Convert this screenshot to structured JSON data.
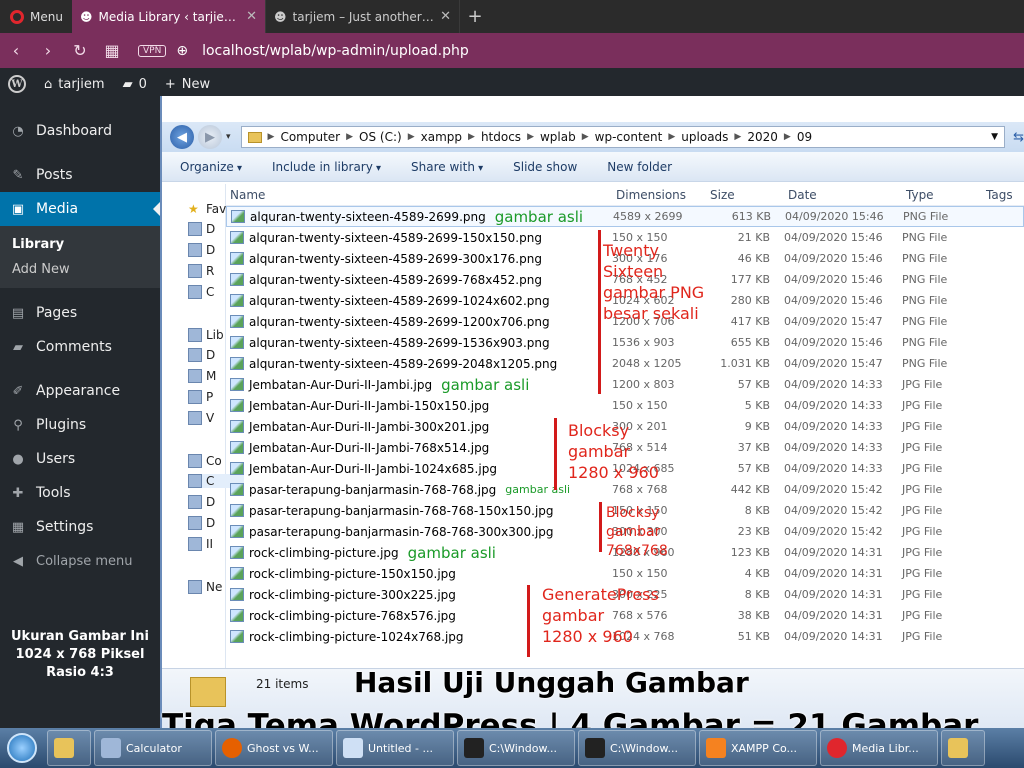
{
  "browser": {
    "menu_label": "Menu",
    "tabs": [
      {
        "label": "Media Library ‹ tarjiem — W"
      },
      {
        "label": "tarjiem – Just another Word"
      }
    ],
    "vpn_label": "VPN",
    "url": "localhost/wplab/wp-admin/upload.php"
  },
  "wp_admin_bar": {
    "site_name": "tarjiem",
    "comments_count": "0",
    "new_label": "New"
  },
  "sidebar": {
    "items": [
      {
        "label": "Dashboard",
        "icon": "dashboard-icon"
      },
      {
        "label": "Posts",
        "icon": "pin-icon"
      },
      {
        "label": "Media",
        "icon": "media-icon"
      },
      {
        "label": "Pages",
        "icon": "page-icon"
      },
      {
        "label": "Comments",
        "icon": "comment-icon"
      },
      {
        "label": "Appearance",
        "icon": "brush-icon"
      },
      {
        "label": "Plugins",
        "icon": "plugin-icon"
      },
      {
        "label": "Users",
        "icon": "user-icon"
      },
      {
        "label": "Tools",
        "icon": "wrench-icon"
      },
      {
        "label": "Settings",
        "icon": "settings-icon"
      }
    ],
    "media_sub": [
      "Library",
      "Add New"
    ],
    "collapse_label": "Collapse menu",
    "caption_lines": [
      "Ukuran Gambar Ini",
      "1024 x 768 Piksel",
      "Rasio 4:3"
    ]
  },
  "explorer": {
    "breadcrumbs": [
      "Computer",
      "OS (C:)",
      "xampp",
      "htdocs",
      "wplab",
      "wp-content",
      "uploads",
      "2020",
      "09"
    ],
    "toolbar": [
      "Organize",
      "Include in library",
      "Share with",
      "Slide show",
      "New folder"
    ],
    "nav_pane": [
      "Fav",
      "D",
      "D",
      "R",
      "C",
      "Lib",
      "D",
      "M",
      "P",
      "V",
      "Co",
      "C",
      "D",
      "D",
      "II",
      "Ne"
    ],
    "columns": [
      "Name",
      "Dimensions",
      "Size",
      "Date",
      "Type",
      "Tags"
    ],
    "files": [
      {
        "name": "alquran-twenty-sixteen-4589-2699.png",
        "dim": "4589 x 2699",
        "size": "613 KB",
        "date": "04/09/2020 15:46",
        "type": "PNG File",
        "note": "gambar asli"
      },
      {
        "name": "alquran-twenty-sixteen-4589-2699-150x150.png",
        "dim": "150 x 150",
        "size": "21 KB",
        "date": "04/09/2020 15:46",
        "type": "PNG File",
        "note": ""
      },
      {
        "name": "alquran-twenty-sixteen-4589-2699-300x176.png",
        "dim": "300 x 176",
        "size": "46 KB",
        "date": "04/09/2020 15:46",
        "type": "PNG File",
        "note": ""
      },
      {
        "name": "alquran-twenty-sixteen-4589-2699-768x452.png",
        "dim": "768 x 452",
        "size": "177 KB",
        "date": "04/09/2020 15:46",
        "type": "PNG File",
        "note": ""
      },
      {
        "name": "alquran-twenty-sixteen-4589-2699-1024x602.png",
        "dim": "1024 x 602",
        "size": "280 KB",
        "date": "04/09/2020 15:46",
        "type": "PNG File",
        "note": ""
      },
      {
        "name": "alquran-twenty-sixteen-4589-2699-1200x706.png",
        "dim": "1200 x 706",
        "size": "417 KB",
        "date": "04/09/2020 15:47",
        "type": "PNG File",
        "note": ""
      },
      {
        "name": "alquran-twenty-sixteen-4589-2699-1536x903.png",
        "dim": "1536 x 903",
        "size": "655 KB",
        "date": "04/09/2020 15:46",
        "type": "PNG File",
        "note": ""
      },
      {
        "name": "alquran-twenty-sixteen-4589-2699-2048x1205.png",
        "dim": "2048 x 1205",
        "size": "1.031 KB",
        "date": "04/09/2020 15:47",
        "type": "PNG File",
        "note": ""
      },
      {
        "name": "Jembatan-Aur-Duri-II-Jambi.jpg",
        "dim": "1200 x 803",
        "size": "57 KB",
        "date": "04/09/2020 14:33",
        "type": "JPG File",
        "note": "gambar asli"
      },
      {
        "name": "Jembatan-Aur-Duri-II-Jambi-150x150.jpg",
        "dim": "150 x 150",
        "size": "5 KB",
        "date": "04/09/2020 14:33",
        "type": "JPG File",
        "note": ""
      },
      {
        "name": "Jembatan-Aur-Duri-II-Jambi-300x201.jpg",
        "dim": "300 x 201",
        "size": "9 KB",
        "date": "04/09/2020 14:33",
        "type": "JPG File",
        "note": ""
      },
      {
        "name": "Jembatan-Aur-Duri-II-Jambi-768x514.jpg",
        "dim": "768 x 514",
        "size": "37 KB",
        "date": "04/09/2020 14:33",
        "type": "JPG File",
        "note": ""
      },
      {
        "name": "Jembatan-Aur-Duri-II-Jambi-1024x685.jpg",
        "dim": "1024 x 685",
        "size": "57 KB",
        "date": "04/09/2020 14:33",
        "type": "JPG File",
        "note": ""
      },
      {
        "name": "pasar-terapung-banjarmasin-768-768.jpg",
        "dim": "768 x 768",
        "size": "442 KB",
        "date": "04/09/2020 15:42",
        "type": "JPG File",
        "note": "gambar asli"
      },
      {
        "name": "pasar-terapung-banjarmasin-768-768-150x150.jpg",
        "dim": "150 x 150",
        "size": "8 KB",
        "date": "04/09/2020 15:42",
        "type": "JPG File",
        "note": ""
      },
      {
        "name": "pasar-terapung-banjarmasin-768-768-300x300.jpg",
        "dim": "300 x 300",
        "size": "23 KB",
        "date": "04/09/2020 15:42",
        "type": "JPG File",
        "note": ""
      },
      {
        "name": "rock-climbing-picture.jpg",
        "dim": "1280 x 960",
        "size": "123 KB",
        "date": "04/09/2020 14:31",
        "type": "JPG File",
        "note": "gambar asli"
      },
      {
        "name": "rock-climbing-picture-150x150.jpg",
        "dim": "150 x 150",
        "size": "4 KB",
        "date": "04/09/2020 14:31",
        "type": "JPG File",
        "note": ""
      },
      {
        "name": "rock-climbing-picture-300x225.jpg",
        "dim": "300 x 225",
        "size": "8 KB",
        "date": "04/09/2020 14:31",
        "type": "JPG File",
        "note": ""
      },
      {
        "name": "rock-climbing-picture-768x576.jpg",
        "dim": "768 x 576",
        "size": "38 KB",
        "date": "04/09/2020 14:31",
        "type": "JPG File",
        "note": ""
      },
      {
        "name": "rock-climbing-picture-1024x768.jpg",
        "dim": "1024 x 768",
        "size": "51 KB",
        "date": "04/09/2020 14:31",
        "type": "JPG File",
        "note": ""
      }
    ],
    "status_count": "21 items"
  },
  "annotations": {
    "twenty_sixteen": [
      "Twenty",
      "Sixteen",
      "gambar PNG",
      "besar sekali"
    ],
    "blocksy_1": [
      "Blocksy",
      "gambar",
      "1280 x 960"
    ],
    "blocksy_2": [
      "Blocksy",
      "gambar",
      "768x768"
    ],
    "generatepress": [
      "GeneratePress",
      "gambar",
      "1280 x 960"
    ]
  },
  "headline": {
    "line1": "Hasil Uji Unggah Gambar",
    "line2": "Tiga Tema WordPress | 4 Gambar = 21 Gambar"
  },
  "taskbar": [
    {
      "label": ""
    },
    {
      "label": "Calculator"
    },
    {
      "label": "Ghost vs W..."
    },
    {
      "label": "Untitled - ..."
    },
    {
      "label": "C:\\Window..."
    },
    {
      "label": "C:\\Window..."
    },
    {
      "label": "XAMPP Co..."
    },
    {
      "label": "Media Libr..."
    },
    {
      "label": ""
    }
  ]
}
